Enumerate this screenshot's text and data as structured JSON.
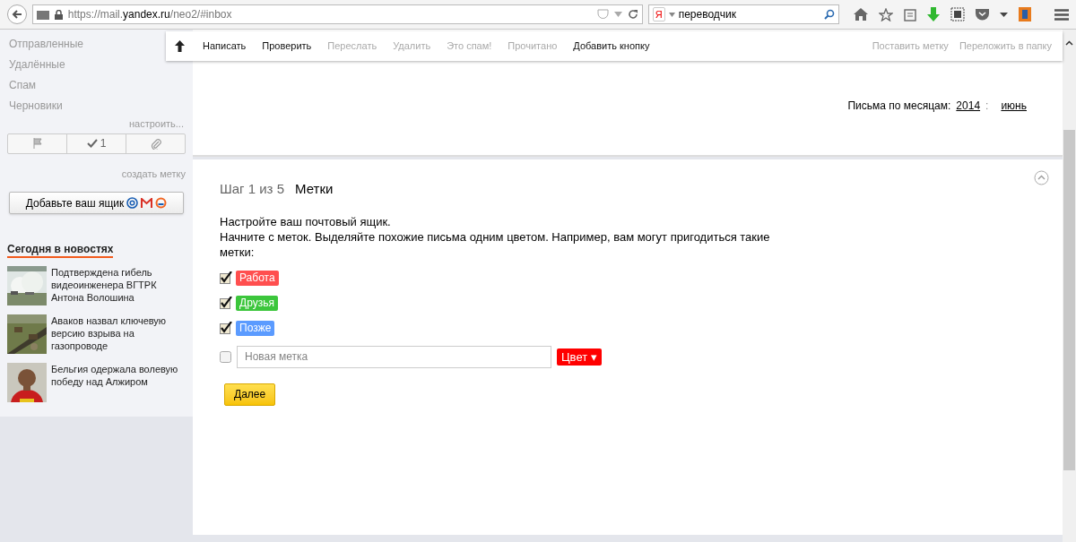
{
  "browser": {
    "url_prefix": "https://mail.",
    "url_domain": "yandex.ru",
    "url_path": "/neo2/#inbox",
    "search_value": "переводчик",
    "search_engine_letter": "Я"
  },
  "toolbar": {
    "buttons": [
      {
        "label": "Написать",
        "disabled": false
      },
      {
        "label": "Проверить",
        "disabled": false
      },
      {
        "label": "Переслать",
        "disabled": true
      },
      {
        "label": "Удалить",
        "disabled": true
      },
      {
        "label": "Это спам!",
        "disabled": true
      },
      {
        "label": "Прочитано",
        "disabled": true
      },
      {
        "label": "Добавить кнопку",
        "disabled": false
      }
    ],
    "right_buttons": [
      {
        "label": "Поставить метку",
        "disabled": true
      },
      {
        "label": "Переложить в папку",
        "disabled": true
      }
    ]
  },
  "sidebar": {
    "folders": [
      "Отправленные",
      "Удалённые",
      "Спам",
      "Черновики"
    ],
    "configure_link": "настроить...",
    "filter_count": "1",
    "create_label_link": "создать метку",
    "add_mailbox_button": "Добавьте ваш ящик",
    "news_title": "Сегодня в новостях",
    "news": [
      {
        "text": "Подтверждена гибель видеоинженера ВГТРК Антона Волошина",
        "kind": "smoke"
      },
      {
        "text": "Аваков назвал ключевую версию взрыва на газопроводе",
        "kind": "field"
      },
      {
        "text": "Бельгия одержала волевую победу над Алжиром",
        "kind": "person"
      }
    ]
  },
  "archive": {
    "label": "Письма по месяцам:",
    "year": "2014",
    "separator": ":",
    "month": "июнь"
  },
  "wizard": {
    "step": "Шаг 1 из 5",
    "title": "Метки",
    "intro": "Настройте ваш почтовый ящик.",
    "text": "Начните с меток. Выделяйте похожие письма одним цветом. Например, вам могут пригодиться такие метки:",
    "labels": [
      {
        "name": "Работа",
        "checked": true,
        "color": "#ff4f4f"
      },
      {
        "name": "Друзья",
        "checked": true,
        "color": "#3cc63c"
      },
      {
        "name": "Позже",
        "checked": true,
        "color": "#5b9bff"
      }
    ],
    "new_label": {
      "placeholder": "Новая метка",
      "checked": false
    },
    "color_button": "Цвет ▾",
    "next_button": "Далее"
  }
}
